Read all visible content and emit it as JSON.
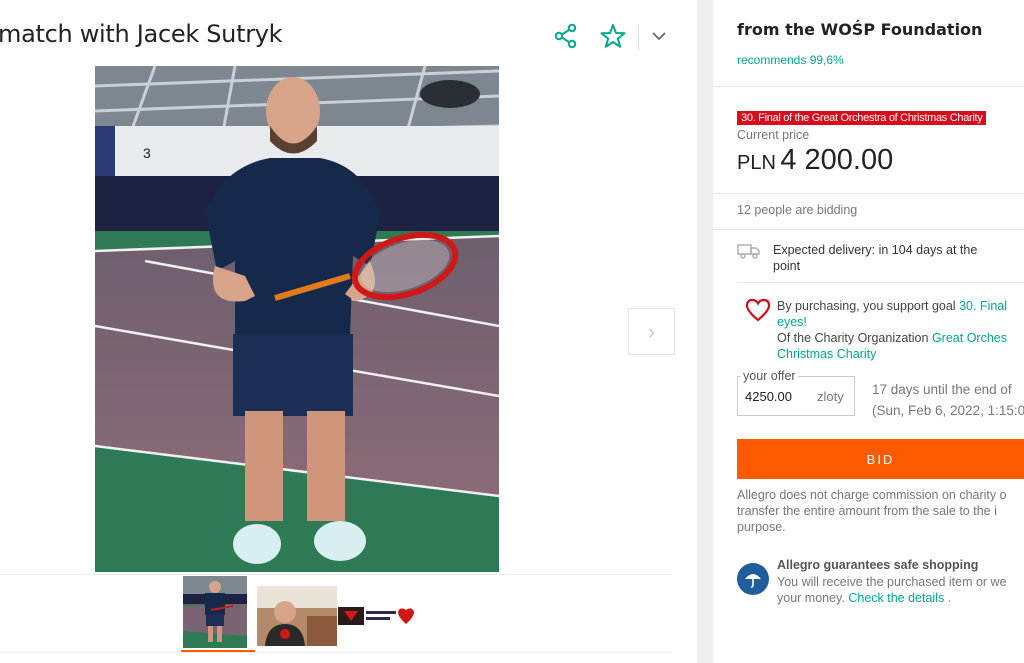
{
  "listing": {
    "title": "match with Jacek Sutryk",
    "share_icon": "share-icon",
    "favorite_icon": "star-icon",
    "more_icon": "chevron-down-icon",
    "next_icon": "chevron-right-icon",
    "next_glyph": "›"
  },
  "gallery": {
    "thumbnails": [
      "photo-tennis-player",
      "photo-man-in-office",
      "logo-wosp-heart"
    ]
  },
  "seller": {
    "name": "from the WOŚP Foundation",
    "recommends": "recommends 99,6%"
  },
  "offer": {
    "badge": "30. Final of the Great Orchestra of Christmas Charity",
    "current_price_label": "Current price",
    "currency": "PLN",
    "price": "4 200.00",
    "bidding": "12 people are bidding",
    "delivery_line1": "Expected delivery: in 104 days at the",
    "delivery_line2": "point",
    "support_prefix": "By purchasing, you support goal",
    "support_goal_part1": "30. Final",
    "support_goal_part2": "eyes!",
    "org_prefix": "Of the Charity Organization",
    "org_name_part1": "Great Orches",
    "org_name_part2": "Christmas Charity",
    "your_offer_label": "your offer",
    "your_offer_value": "4250.00",
    "your_offer_unit": "zloty",
    "ends_line1": "17 days until the end of",
    "ends_line2": "(Sun, Feb 6, 2022, 1:15:0",
    "bid_label": "BID",
    "commission_line1": "Allegro does not charge commission on charity o",
    "commission_line2": "transfer the entire amount from the sale to the i",
    "commission_line3": "purpose."
  },
  "guarantee": {
    "title": "Allegro guarantees safe shopping",
    "line1": "You will receive the purchased item or we",
    "line2_prefix": "your money.",
    "link": "Check the details",
    "line2_suffix": "."
  },
  "colors": {
    "accent": "#00a790",
    "bid_button": "#ff5a00",
    "badge": "#d80b1b",
    "heart": "#d80b1b"
  }
}
